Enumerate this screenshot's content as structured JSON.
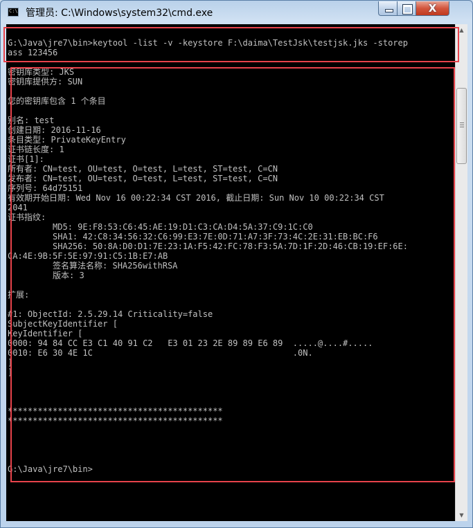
{
  "window": {
    "title": "管理员: C:\\Windows\\system32\\cmd.exe",
    "icon": "cmd-icon",
    "icon_text": "C:\\"
  },
  "controls": {
    "minimize": "minimize-icon",
    "maximize": "maximize-icon",
    "close": "close-icon",
    "close_glyph": "X"
  },
  "colors": {
    "console_bg": "#000000",
    "console_text": "#c0c0c0",
    "highlight": "#e8434b",
    "close_button": "#c7432a"
  },
  "console": {
    "lines": [
      "G:\\Java\\jre7\\bin>keytool -list -v -keystore F:\\daima\\TestJsk\\testjsk.jks -storep",
      "ass 123456",
      "",
      "密钥库类型: JKS",
      "密钥库提供方: SUN",
      "",
      "您的密钥库包含 1 个条目",
      "",
      "别名: test",
      "创建日期: 2016-11-16",
      "条目类型: PrivateKeyEntry",
      "证书链长度: 1",
      "证书[1]:",
      "所有者: CN=test, OU=test, O=test, L=test, ST=test, C=CN",
      "发布者: CN=test, OU=test, O=test, L=test, ST=test, C=CN",
      "序列号: 64d75151",
      "有效期开始日期: Wed Nov 16 00:22:34 CST 2016, 截止日期: Sun Nov 10 00:22:34 CST",
      "2041",
      "证书指纹:",
      "         MD5: 9E:F8:53:C6:45:AE:19:D1:C3:CA:D4:5A:37:C9:1C:C0",
      "         SHA1: 42:C8:34:56:32:C6:99:E3:7E:0D:71:A7:3F:73:4C:2E:31:EB:BC:F6",
      "         SHA256: 50:8A:D0:D1:7E:23:1A:F5:42:FC:78:F3:5A:7D:1F:2D:46:CB:19:EF:6E:",
      "CA:4E:9B:5F:5E:97:91:C5:1B:E7:AB",
      "         签名算法名称: SHA256withRSA",
      "         版本: 3",
      "",
      "扩展:",
      "",
      "#1: ObjectId: 2.5.29.14 Criticality=false",
      "SubjectKeyIdentifier [",
      "KeyIdentifier [",
      "0000: 94 84 CC E3 C1 40 91 C2   E3 01 23 2E 89 89 E6 89  .....@....#.....",
      "0010: E6 30 4E 1C                                        .0N.",
      "]",
      "]",
      "",
      "",
      "",
      "*******************************************",
      "*******************************************",
      "",
      "",
      "",
      "",
      "G:\\Java\\jre7\\bin>"
    ]
  }
}
